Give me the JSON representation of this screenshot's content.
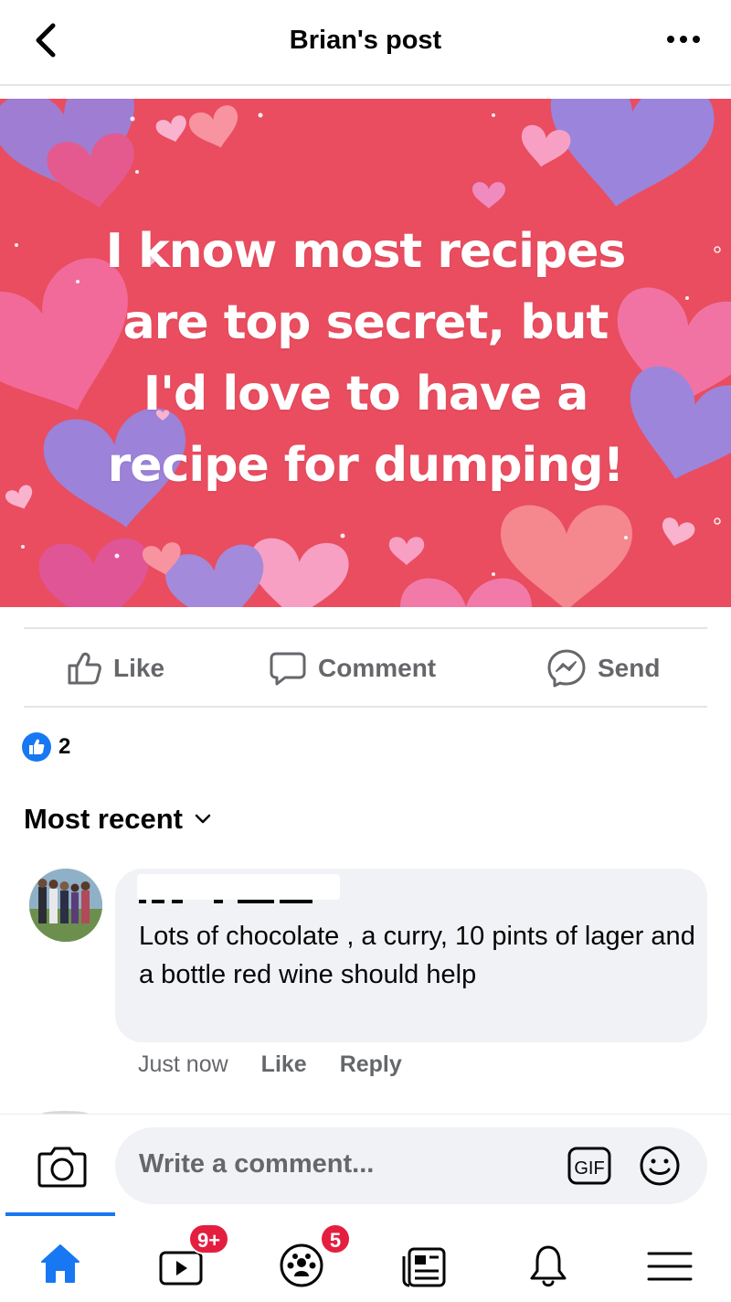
{
  "header": {
    "title": "Brian's post"
  },
  "post": {
    "text": "I know most recipes\nare top secret, but\nI'd love to have a\nrecipe for dumping!",
    "background_color": "#e94d5f"
  },
  "actions": {
    "like": "Like",
    "comment": "Comment",
    "send": "Send"
  },
  "reactions": {
    "count": "2"
  },
  "sort": {
    "label": "Most recent"
  },
  "comment": {
    "text": "Lots of chocolate , a curry, 10 pints of lager and a bottle red wine should help",
    "time": "Just now",
    "like": "Like",
    "reply": "Reply"
  },
  "composer": {
    "placeholder": "Write a comment...",
    "gif": "GIF"
  },
  "nav": {
    "items": [
      {
        "name": "home",
        "active": true
      },
      {
        "name": "video",
        "badge": "9+"
      },
      {
        "name": "groups",
        "badge": "5"
      },
      {
        "name": "news"
      },
      {
        "name": "notifications"
      },
      {
        "name": "menu"
      }
    ]
  },
  "colors": {
    "accent": "#1877f2",
    "badge": "#e41e3f",
    "secondary_text": "#65676b"
  }
}
